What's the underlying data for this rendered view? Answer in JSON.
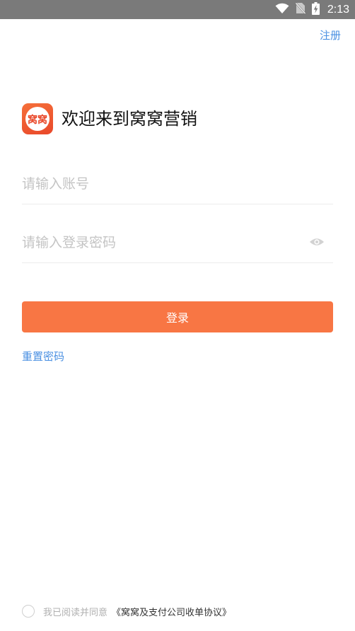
{
  "status_bar": {
    "time": "2:13",
    "icons": [
      "wifi-icon",
      "no-sim-icon",
      "battery-charging-icon"
    ]
  },
  "header": {
    "register_label": "注册"
  },
  "branding": {
    "logo_text": "窝窝",
    "welcome_title": "欢迎来到窝窝营销"
  },
  "form": {
    "account": {
      "value": "",
      "placeholder": "请输入账号"
    },
    "password": {
      "value": "",
      "placeholder": "请输入登录密码",
      "toggle_icon": "eye-icon"
    },
    "login_label": "登录",
    "reset_password_label": "重置密码"
  },
  "agreement": {
    "checked": false,
    "prefix_text": "我已阅读并同意",
    "link_text": "《窝窝及支付公司收单协议》"
  },
  "colors": {
    "accent": "#f87644",
    "link": "#4a90e2",
    "status_bar": "#7a7a7a",
    "placeholder": "#c4c4c4"
  }
}
